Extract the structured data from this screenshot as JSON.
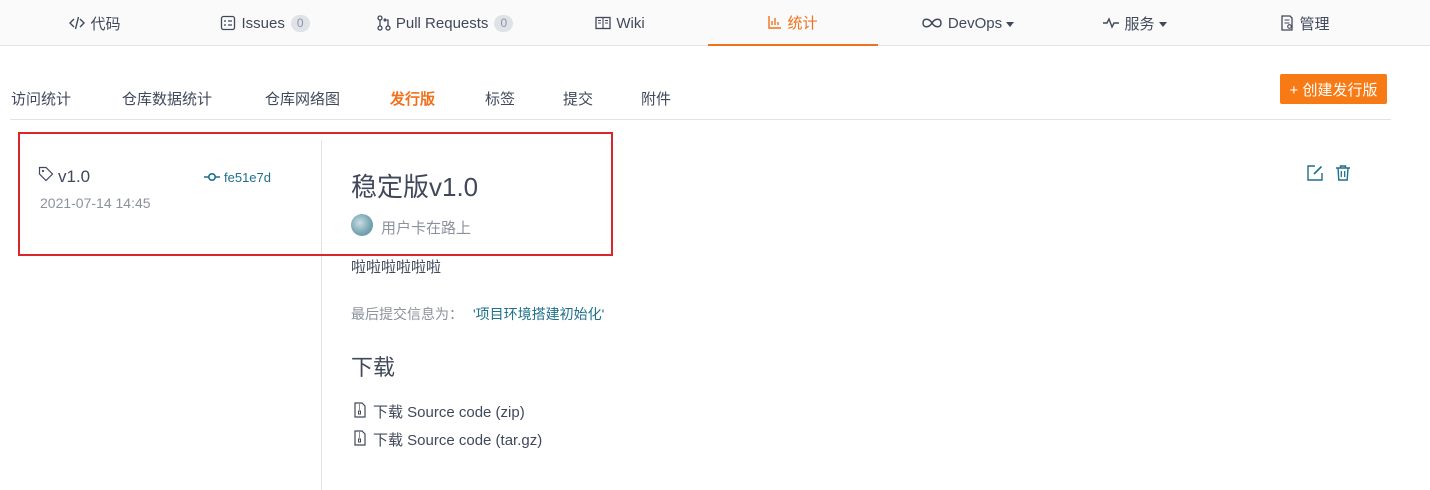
{
  "nav": {
    "tabs": [
      {
        "label": "代码",
        "icon": "code-icon"
      },
      {
        "label": "Issues",
        "count": "0",
        "icon": "issues-icon"
      },
      {
        "label": "Pull Requests",
        "count": "0",
        "icon": "pull-request-icon"
      },
      {
        "label": "Wiki",
        "icon": "book-icon"
      },
      {
        "label": "统计",
        "icon": "bar-chart-icon",
        "active": true
      },
      {
        "label": "DevOps",
        "icon": "infinity-icon"
      },
      {
        "label": "服务",
        "icon": "pulse-icon"
      },
      {
        "label": "管理",
        "icon": "settings-doc-icon"
      }
    ]
  },
  "subnav": {
    "tabs": [
      "访问统计",
      "仓库数据统计",
      "仓库网络图",
      "发行版",
      "标签",
      "提交",
      "附件"
    ],
    "active": "发行版",
    "create_label": "+ 创建发行版"
  },
  "release": {
    "tag": "v1.0",
    "commit": "fe51e7d",
    "date": "2021-07-14 14:45",
    "title": "稳定版v1.0",
    "author": "用户卡在路上",
    "description": "啦啦啦啦啦啦",
    "last_commit_label": "最后提交信息为：",
    "last_commit_message": "'项目环境搭建初始化'",
    "download_heading": "下载",
    "downloads": [
      "下载 Source code (zip)",
      "下载 Source code (tar.gz)"
    ]
  },
  "colors": {
    "accent": "#f2711c",
    "button": "#f87a14",
    "link": "#1e6f8c",
    "highlight_border": "#d9252b"
  }
}
